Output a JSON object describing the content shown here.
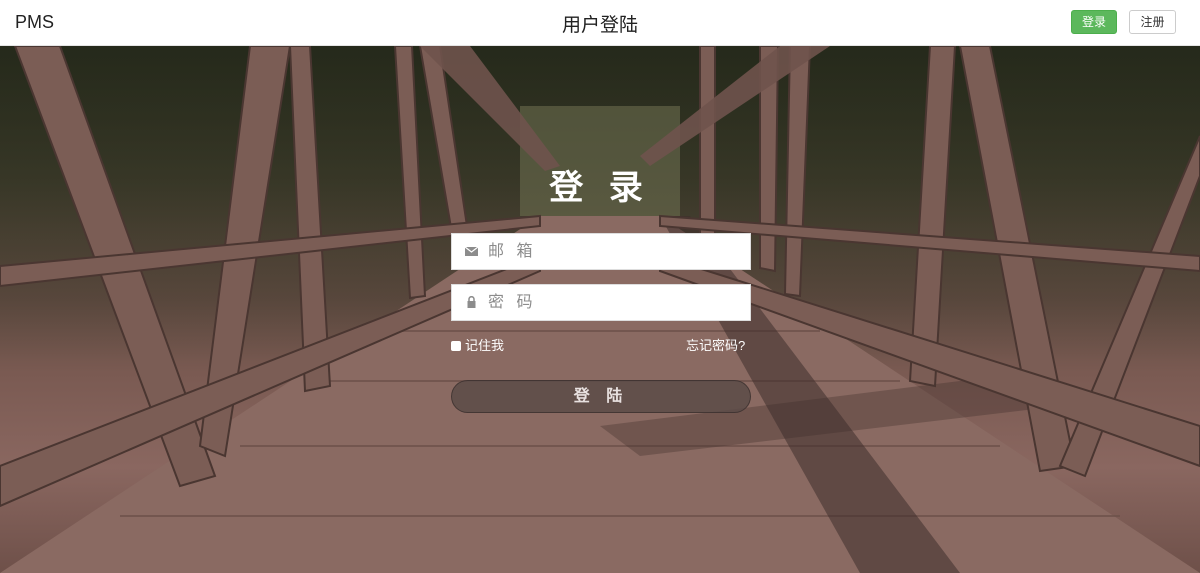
{
  "navbar": {
    "brand": "PMS",
    "title": "用户登陆",
    "login_label": "登录",
    "register_label": "注册",
    "login_color": "#5cb85c"
  },
  "login": {
    "heading": "登 录",
    "email_placeholder": "邮 箱",
    "email_icon": "envelope-icon",
    "password_placeholder": "密 码",
    "password_icon": "lock-icon",
    "remember_label": "记住我",
    "forgot_label": "忘记密码?",
    "submit_label": "登 陆"
  }
}
